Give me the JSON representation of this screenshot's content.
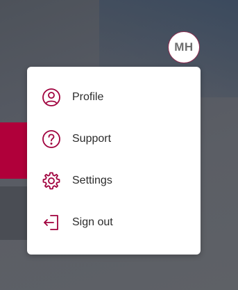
{
  "avatar": {
    "initials": "MH"
  },
  "menu": {
    "items": [
      {
        "label": "Profile",
        "icon": "profile-icon"
      },
      {
        "label": "Support",
        "icon": "help-icon"
      },
      {
        "label": "Settings",
        "icon": "gear-icon"
      },
      {
        "label": "Sign out",
        "icon": "sign-out-icon"
      }
    ]
  },
  "colors": {
    "accent": "#a0003d",
    "banner": "#b0003a",
    "menu_bg": "#ffffff"
  }
}
